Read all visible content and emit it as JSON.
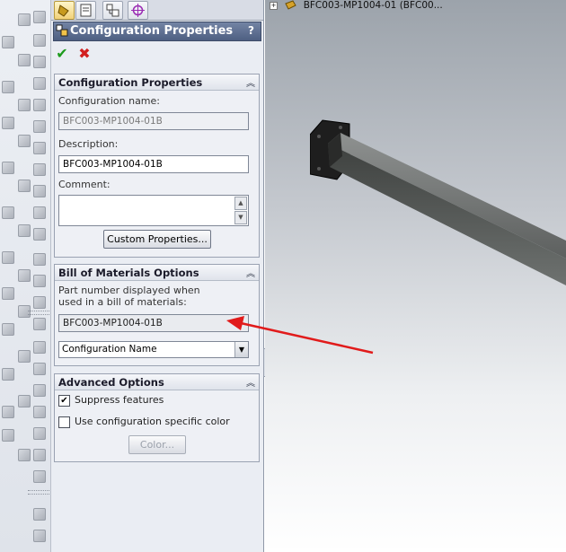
{
  "property_manager": {
    "title": "Configuration Properties",
    "help_label": "?",
    "groups": {
      "config_props": {
        "title": "Configuration Properties",
        "name_label": "Configuration name:",
        "name_value": "BFC003-MP1004-01B",
        "description_label": "Description:",
        "description_value": "BFC003-MP1004-01B",
        "comment_label": "Comment:",
        "comment_value": "",
        "custom_props_button": "Custom Properties..."
      },
      "bom": {
        "title": "Bill of Materials Options",
        "pn_label_line1": "Part number displayed when",
        "pn_label_line2": "used in a bill of materials:",
        "pn_value": "BFC003-MP1004-01B",
        "pn_source_selected": "Configuration Name"
      },
      "advanced": {
        "title": "Advanced Options",
        "suppress_label": "Suppress features",
        "suppress_checked": true,
        "specific_color_label": "Use configuration specific color",
        "specific_color_checked": false,
        "color_button": "Color..."
      }
    }
  },
  "viewport": {
    "tree_item": "BFC003-MP1004-01  (BFC00..."
  },
  "colors": {
    "accent_arrow": "#e11b1b",
    "header_bg": "#5a6b8c"
  }
}
